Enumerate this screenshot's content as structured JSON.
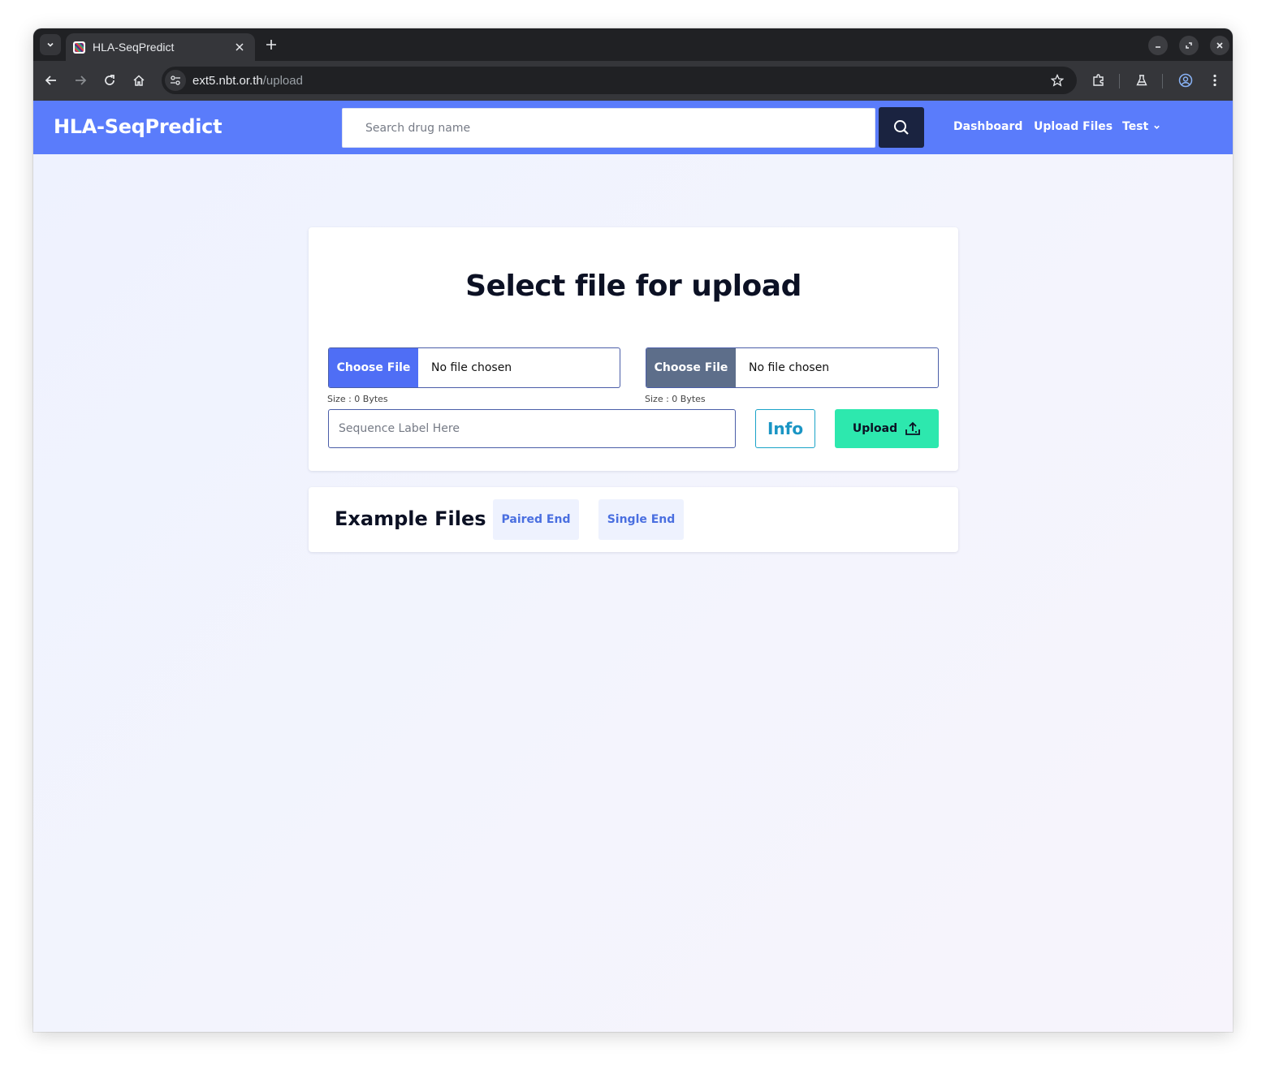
{
  "browser": {
    "tab_title": "HLA-SeqPredict",
    "url_host": "ext5.nbt.or.th",
    "url_path": "/upload"
  },
  "navbar": {
    "brand": "HLA-SeqPredict",
    "search_placeholder": "Search drug name",
    "links": {
      "dashboard": "Dashboard",
      "upload_files": "Upload Files",
      "user": "Test"
    },
    "colors": {
      "background": "#5a7cfb",
      "search_button": "#1a2340"
    }
  },
  "upload_card": {
    "title": "Select file for upload",
    "file_inputs": [
      {
        "button_label": "Choose File",
        "status": "No file chosen",
        "size_text": "Size : 0 Bytes",
        "button_color": "#4f6ef5"
      },
      {
        "button_label": "Choose File",
        "status": "No file chosen",
        "size_text": "Size : 0 Bytes",
        "button_color": "#5d6e8a"
      }
    ],
    "sequence_placeholder": "Sequence Label Here",
    "info_label": "Info",
    "upload_label": "Upload",
    "colors": {
      "upload": "#2de8ae",
      "info": "#1a95c4"
    }
  },
  "examples_card": {
    "label": "Example Files :",
    "buttons": [
      "Paired End",
      "Single End"
    ]
  }
}
